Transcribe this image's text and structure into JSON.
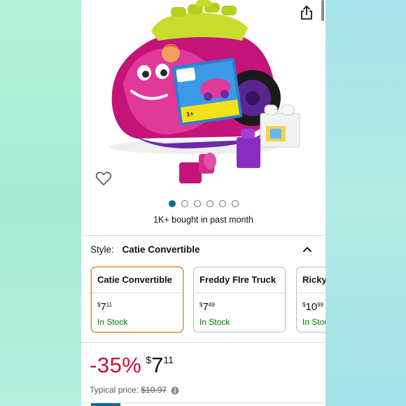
{
  "product": {
    "image_alt": "Mega Bloks Catie Convertible toy car",
    "carousel": {
      "total": 6,
      "active_index": 0
    },
    "bought_text": "1K+ bought in past month"
  },
  "style": {
    "label": "Style:",
    "selected": "Catie Convertible",
    "variants": [
      {
        "name": "Catie Convertible",
        "currency": "$",
        "whole": "7",
        "fraction": "11",
        "stock": "In Stock",
        "selected": true
      },
      {
        "name": "Freddy FIre Truck",
        "currency": "$",
        "whole": "7",
        "fraction": "49",
        "stock": "In Stock",
        "selected": false
      },
      {
        "name": "Ricky",
        "currency": "$",
        "whole": "10",
        "fraction": "99",
        "stock": "In Stock",
        "selected": false
      }
    ]
  },
  "price": {
    "discount": "-35%",
    "currency": "$",
    "whole": "7",
    "fraction": "11",
    "typical_label": "Typical price:",
    "typical_value": "$10.97"
  },
  "colors": {
    "deal_red": "#cc0c39",
    "in_stock_green": "#007600",
    "selected_border": "#e3893a",
    "carousel_active": "#0f6c8f"
  },
  "icons": [
    "share-icon",
    "heart-icon",
    "chevron-up-icon",
    "info-icon"
  ]
}
